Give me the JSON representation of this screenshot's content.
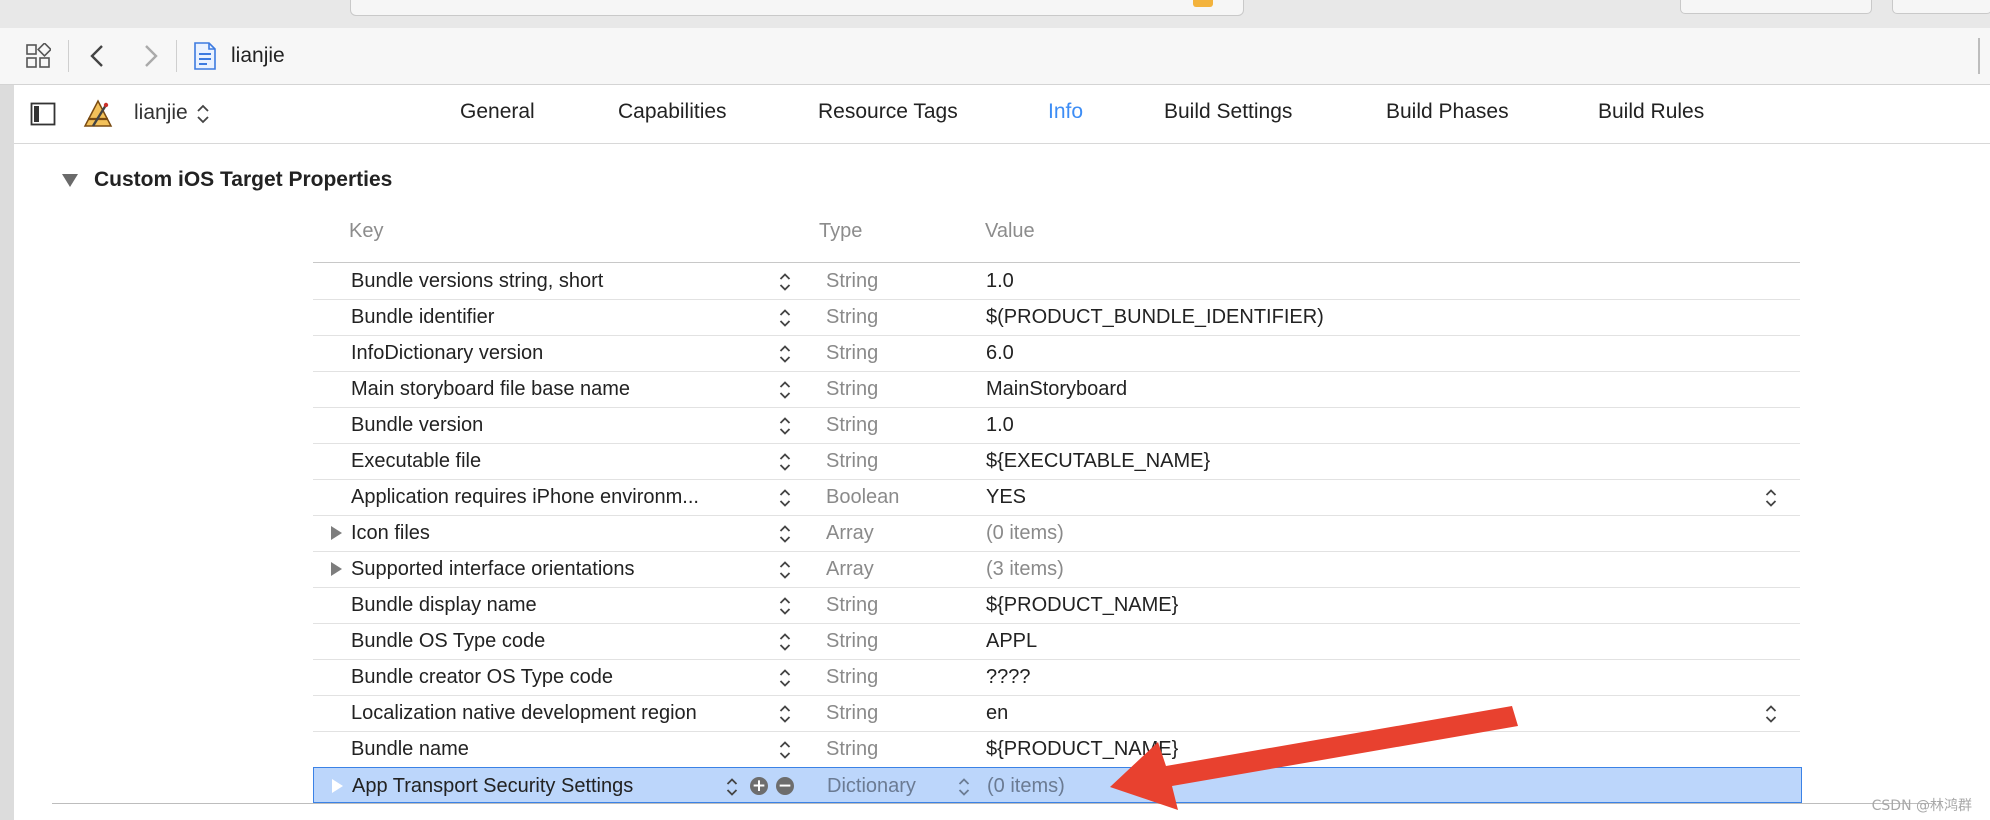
{
  "window": {
    "file_name": "lianjie"
  },
  "target": {
    "name": "lianjie"
  },
  "tabs": [
    {
      "label": "General"
    },
    {
      "label": "Capabilities"
    },
    {
      "label": "Resource Tags"
    },
    {
      "label": "Info",
      "active": true
    },
    {
      "label": "Build Settings"
    },
    {
      "label": "Build Phases"
    },
    {
      "label": "Build Rules"
    }
  ],
  "section": {
    "title": "Custom iOS Target Properties",
    "columns": {
      "key": "Key",
      "type": "Type",
      "value": "Value"
    },
    "rows": [
      {
        "key": "Bundle versions string, short",
        "type": "String",
        "value": "1.0"
      },
      {
        "key": "Bundle identifier",
        "type": "String",
        "value": "$(PRODUCT_BUNDLE_IDENTIFIER)"
      },
      {
        "key": "InfoDictionary version",
        "type": "String",
        "value": "6.0"
      },
      {
        "key": "Main storyboard file base name",
        "type": "String",
        "value": "MainStoryboard"
      },
      {
        "key": "Bundle version",
        "type": "String",
        "value": "1.0"
      },
      {
        "key": "Executable file",
        "type": "String",
        "value": "${EXECUTABLE_NAME}"
      },
      {
        "key": "Application requires iPhone environm...",
        "type": "Boolean",
        "value": "YES",
        "value_popup": true
      },
      {
        "key": "Icon files",
        "type": "Array",
        "value": "(0 items)",
        "expandable": true,
        "muted": true
      },
      {
        "key": "Supported interface orientations",
        "type": "Array",
        "value": "(3 items)",
        "expandable": true,
        "muted": true
      },
      {
        "key": "Bundle display name",
        "type": "String",
        "value": "${PRODUCT_NAME}"
      },
      {
        "key": "Bundle OS Type code",
        "type": "String",
        "value": "APPL"
      },
      {
        "key": "Bundle creator OS Type code",
        "type": "String",
        "value": "????"
      },
      {
        "key": "Localization native development region",
        "type": "String",
        "value": "en",
        "value_popup": true
      },
      {
        "key": "Bundle name",
        "type": "String",
        "value": "${PRODUCT_NAME}"
      },
      {
        "key": "App Transport Security Settings",
        "type": "Dictionary",
        "value": "(0 items)",
        "expandable": true,
        "muted": true,
        "selected": true
      }
    ]
  },
  "watermark": "CSDN @林鸿群",
  "colors": {
    "accent": "#3d8df5",
    "selection": "#bcd6fb",
    "annotation_arrow": "#e8412f"
  },
  "icons": {
    "grid": "related-items-grid-icon",
    "back": "chevron-left-icon",
    "forward": "chevron-right-icon",
    "file": "plist-file-icon",
    "sidebar": "sidebar-toggle-icon",
    "target": "app-target-icon",
    "add": "plus-circle-icon",
    "remove": "minus-circle-icon"
  }
}
